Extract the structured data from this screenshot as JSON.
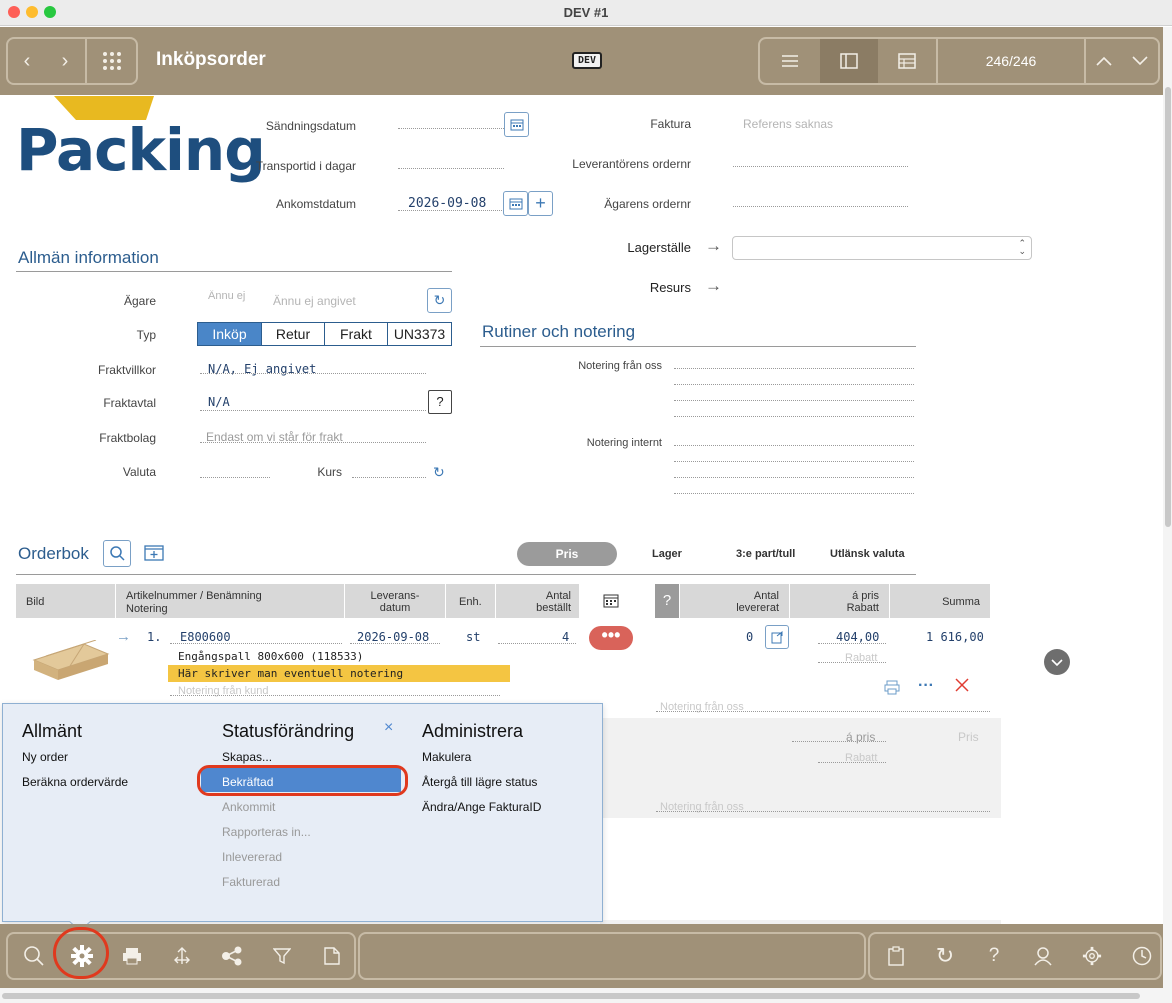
{
  "window": {
    "title": "DEV #1"
  },
  "toolbar": {
    "title": "Inköpsorder",
    "dev_badge": "DEV",
    "record_count": "246/246"
  },
  "logo": {
    "text": "Packing"
  },
  "header_fields": {
    "sandningsdatum": {
      "label": "Sändningsdatum",
      "value": ""
    },
    "transporttid": {
      "label": "Transportid i dagar",
      "value": ""
    },
    "ankomstdatum": {
      "label": "Ankomstdatum",
      "value": "2026-09-08"
    },
    "faktura": {
      "label": "Faktura",
      "placeholder": "Referens saknas"
    },
    "leverantorens_ordernr": {
      "label": "Leverantörens ordernr",
      "value": ""
    },
    "agarens_ordernr": {
      "label": "Ägarens ordernr",
      "value": ""
    },
    "lagerstalle": {
      "label": "Lagerställe",
      "value": ""
    },
    "resurs": {
      "label": "Resurs"
    }
  },
  "general": {
    "title": "Allmän information",
    "agare": {
      "label": "Ägare",
      "placeholder_small": "Ännu ej",
      "placeholder": "Ännu ej angivet"
    },
    "typ": {
      "label": "Typ",
      "options": [
        "Inköp",
        "Retur",
        "Frakt",
        "UN3373"
      ],
      "selected": "Inköp"
    },
    "fraktvillkor": {
      "label": "Fraktvillkor",
      "value": "N/A, Ej angivet"
    },
    "fraktavtal": {
      "label": "Fraktavtal",
      "value": "N/A",
      "help": "?"
    },
    "fraktbolag": {
      "label": "Fraktbolag",
      "placeholder": "Endast om vi står för frakt"
    },
    "valuta": {
      "label": "Valuta",
      "value": ""
    },
    "kurs": {
      "label": "Kurs",
      "value": ""
    }
  },
  "routines": {
    "title": "Rutiner och notering",
    "notering_fran_oss": "Notering från oss",
    "notering_internt": "Notering internt"
  },
  "orderbook": {
    "title": "Orderbok",
    "tabs": {
      "pris": "Pris",
      "lager": "Lager",
      "tredje_part": "3:e part/tull",
      "utlansk_valuta": "Utlänsk valuta"
    },
    "columns": {
      "bild": "Bild",
      "artikel": "Artikelnummer / Benämning",
      "notering": "Notering",
      "leverans_1": "Leverans-",
      "leverans_2": "datum",
      "enh": "Enh.",
      "antal_bestallt_1": "Antal",
      "antal_bestallt_2": "beställt",
      "help": "?",
      "antal_levererat_1": "Antal",
      "antal_levererat_2": "levererat",
      "apris_1": "á pris",
      "apris_2": "Rabatt",
      "summa": "Summa"
    },
    "rows": [
      {
        "num": "1.",
        "artikelnummer": "E800600",
        "benamning": "Engångspall 800x600 (118533)",
        "notering": "Här skriver man eventuell notering",
        "notering_kund_placeholder": "Notering från kund",
        "leveransdatum": "2026-09-08",
        "enh": "st",
        "antal_bestallt": "4",
        "antal_levererat": "0",
        "apris": "404,00",
        "rabatt_placeholder": "Rabatt",
        "summa": "1 616,00",
        "notering_oss_placeholder": "Notering från oss"
      }
    ],
    "new_row": {
      "apris_placeholder": "á pris",
      "pris_placeholder": "Pris",
      "rabatt_placeholder": "Rabatt",
      "notering_oss_placeholder": "Notering från oss"
    }
  },
  "popup": {
    "col1": {
      "title": "Allmänt",
      "items": [
        "Ny order",
        "Beräkna ordervärde"
      ]
    },
    "col2": {
      "title": "Statusförändring",
      "items": [
        "Skapas...",
        "Bekräftad",
        "Ankommit",
        "Rapporteras in...",
        "Inlevererad",
        "Fakturerad"
      ]
    },
    "col3": {
      "title": "Administrera",
      "items": [
        "Makulera",
        "Återgå till lägre status",
        "Ändra/Ange FakturaID"
      ]
    },
    "close": "×"
  },
  "colors": {
    "toolbar": "#a09178",
    "accent": "#2c5d8e",
    "highlight": "#4f87cf",
    "annotation": "#e0391e",
    "note_bg": "#f4c542"
  }
}
